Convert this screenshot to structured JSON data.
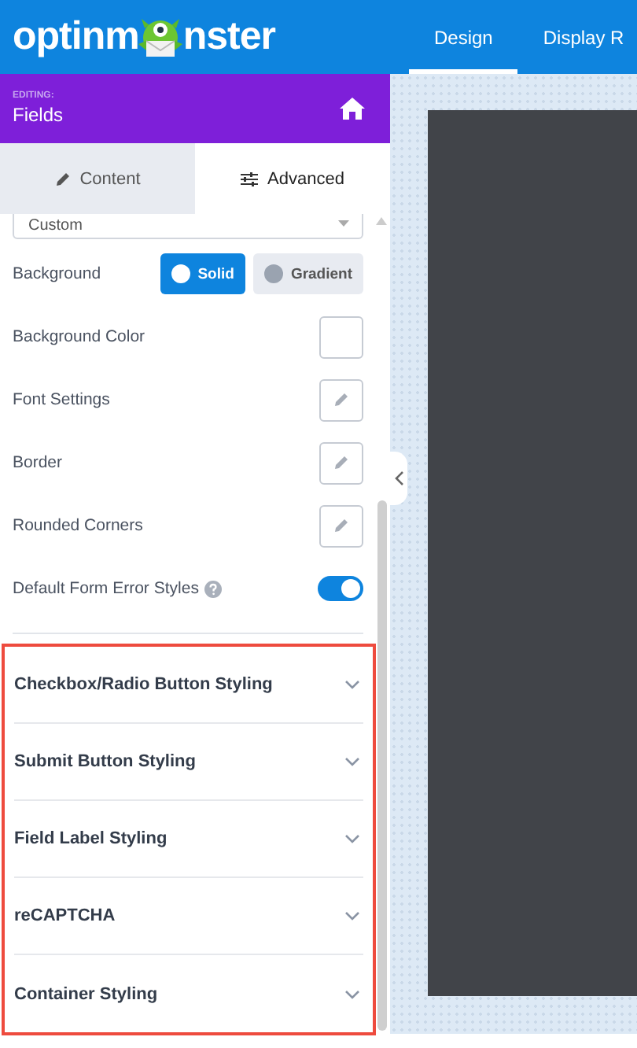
{
  "header": {
    "logo_left": "optinm",
    "logo_right": "nster",
    "tabs": [
      {
        "label": "Design",
        "selected": true
      },
      {
        "label": "Display R",
        "selected": false
      }
    ]
  },
  "editing": {
    "caption": "EDITING:",
    "title": "Fields"
  },
  "panel_tabs": [
    {
      "label": "Content",
      "kind": "pencil",
      "selected": false
    },
    {
      "label": "Advanced",
      "kind": "sliders",
      "selected": true
    }
  ],
  "dropdown": {
    "value": "Custom"
  },
  "settings": [
    {
      "kind": "segmented",
      "label": "Background",
      "options": [
        {
          "label": "Solid",
          "selected": true
        },
        {
          "label": "Gradient",
          "selected": false
        }
      ]
    },
    {
      "kind": "color",
      "label": "Background Color"
    },
    {
      "kind": "edit",
      "label": "Font Settings"
    },
    {
      "kind": "edit",
      "label": "Border"
    },
    {
      "kind": "edit",
      "label": "Rounded Corners"
    },
    {
      "kind": "toggle",
      "label": "Default Form Error Styles",
      "help": true,
      "on": true
    }
  ],
  "sections": [
    {
      "label": "Checkbox/Radio Button Styling",
      "expanded": false
    },
    {
      "label": "Submit Button Styling",
      "expanded": false
    },
    {
      "label": "Field Label Styling",
      "expanded": false
    },
    {
      "label": "reCAPTCHA",
      "expanded": false
    },
    {
      "label": "Container Styling",
      "expanded": false
    }
  ]
}
